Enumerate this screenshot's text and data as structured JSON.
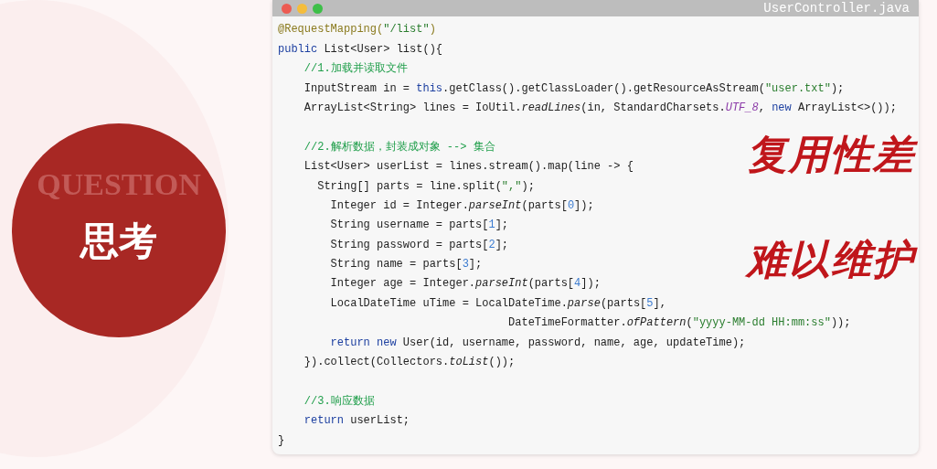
{
  "badge": {
    "watermark": "QUESTION",
    "title": "思考"
  },
  "editor": {
    "title": "UserController.java",
    "lines": [
      {
        "kind": "code",
        "tokens": [
          {
            "kind": "annotation",
            "text": "@RequestMapping("
          },
          {
            "kind": "string",
            "text": "\"/list\""
          },
          {
            "kind": "annotation",
            "text": ")"
          }
        ]
      },
      {
        "kind": "code",
        "tokens": [
          {
            "kind": "keyword",
            "text": "public"
          },
          {
            "kind": "plain",
            "text": " List<User> list(){"
          }
        ]
      },
      {
        "kind": "code",
        "tokens": [
          {
            "kind": "comment",
            "text": "    //1.加载并读取文件"
          }
        ]
      },
      {
        "kind": "code",
        "tokens": [
          {
            "kind": "plain",
            "text": "    InputStream in = "
          },
          {
            "kind": "keyword",
            "text": "this"
          },
          {
            "kind": "plain",
            "text": ".getClass().getClassLoader().getResourceAsStream("
          },
          {
            "kind": "string",
            "text": "\"user.txt\""
          },
          {
            "kind": "plain",
            "text": ");"
          }
        ]
      },
      {
        "kind": "code",
        "tokens": [
          {
            "kind": "plain",
            "text": "    ArrayList<String> lines = IoUtil."
          },
          {
            "kind": "method",
            "text": "readLines"
          },
          {
            "kind": "plain",
            "text": "(in, StandardCharsets."
          },
          {
            "kind": "constant",
            "text": "UTF_8"
          },
          {
            "kind": "plain",
            "text": ", "
          },
          {
            "kind": "keyword",
            "text": "new"
          },
          {
            "kind": "plain",
            "text": " ArrayList<>());"
          }
        ]
      },
      {
        "kind": "blank"
      },
      {
        "kind": "code",
        "tokens": [
          {
            "kind": "comment",
            "text": "    //2.解析数据，封装成对象 --> 集合"
          }
        ]
      },
      {
        "kind": "code",
        "tokens": [
          {
            "kind": "plain",
            "text": "    List<User> userList = lines.stream().map(line -> {"
          }
        ]
      },
      {
        "kind": "code",
        "tokens": [
          {
            "kind": "plain",
            "text": "      String[] parts = line.split("
          },
          {
            "kind": "string",
            "text": "\",\""
          },
          {
            "kind": "plain",
            "text": ");"
          }
        ]
      },
      {
        "kind": "code",
        "tokens": [
          {
            "kind": "plain",
            "text": "        Integer id = Integer."
          },
          {
            "kind": "method",
            "text": "parseInt"
          },
          {
            "kind": "plain",
            "text": "(parts["
          },
          {
            "kind": "number",
            "text": "0"
          },
          {
            "kind": "plain",
            "text": "]);"
          }
        ]
      },
      {
        "kind": "code",
        "tokens": [
          {
            "kind": "plain",
            "text": "        String username = parts["
          },
          {
            "kind": "number",
            "text": "1"
          },
          {
            "kind": "plain",
            "text": "];"
          }
        ]
      },
      {
        "kind": "code",
        "tokens": [
          {
            "kind": "plain",
            "text": "        String password = parts["
          },
          {
            "kind": "number",
            "text": "2"
          },
          {
            "kind": "plain",
            "text": "];"
          }
        ]
      },
      {
        "kind": "code",
        "tokens": [
          {
            "kind": "plain",
            "text": "        String name = parts["
          },
          {
            "kind": "number",
            "text": "3"
          },
          {
            "kind": "plain",
            "text": "];"
          }
        ]
      },
      {
        "kind": "code",
        "tokens": [
          {
            "kind": "plain",
            "text": "        Integer age = Integer."
          },
          {
            "kind": "method",
            "text": "parseInt"
          },
          {
            "kind": "plain",
            "text": "(parts["
          },
          {
            "kind": "number",
            "text": "4"
          },
          {
            "kind": "plain",
            "text": "]);"
          }
        ]
      },
      {
        "kind": "code",
        "tokens": [
          {
            "kind": "plain",
            "text": "        LocalDateTime uTime = LocalDateTime."
          },
          {
            "kind": "method",
            "text": "parse"
          },
          {
            "kind": "plain",
            "text": "(parts["
          },
          {
            "kind": "number",
            "text": "5"
          },
          {
            "kind": "plain",
            "text": "],"
          }
        ]
      },
      {
        "kind": "code",
        "tokens": [
          {
            "kind": "plain",
            "text": "                                   DateTimeFormatter."
          },
          {
            "kind": "method",
            "text": "ofPattern"
          },
          {
            "kind": "plain",
            "text": "("
          },
          {
            "kind": "string",
            "text": "\"yyyy-MM-dd HH:mm:ss\""
          },
          {
            "kind": "plain",
            "text": "));"
          }
        ]
      },
      {
        "kind": "code",
        "tokens": [
          {
            "kind": "keyword",
            "text": "        return new"
          },
          {
            "kind": "plain",
            "text": " User(id, username, password, name, age, updateTime);"
          }
        ]
      },
      {
        "kind": "code",
        "tokens": [
          {
            "kind": "plain",
            "text": "    }).collect(Collectors."
          },
          {
            "kind": "method",
            "text": "toList"
          },
          {
            "kind": "plain",
            "text": "());"
          }
        ]
      },
      {
        "kind": "blank"
      },
      {
        "kind": "code",
        "tokens": [
          {
            "kind": "comment",
            "text": "    //3.响应数据"
          }
        ]
      },
      {
        "kind": "code",
        "tokens": [
          {
            "kind": "keyword",
            "text": "    return"
          },
          {
            "kind": "plain",
            "text": " userList;"
          }
        ]
      },
      {
        "kind": "code",
        "tokens": [
          {
            "kind": "plain",
            "text": "}"
          }
        ]
      }
    ]
  },
  "notes": [
    "复用性差",
    "难以维护"
  ]
}
